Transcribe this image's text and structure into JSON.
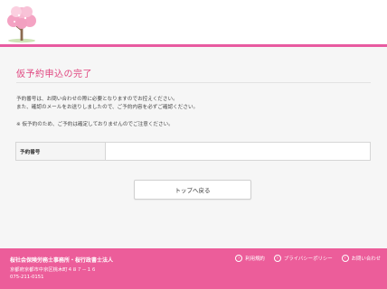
{
  "header": {
    "logo_icon": "cherry-blossom-tree-icon"
  },
  "main": {
    "title": "仮予約申込の完了",
    "messages": [
      "予約番号は、お問い合わせの際に必要となりますのでお控えください。",
      "また、確認のメールをお送りしましたので、ご予約内容を必ずご確認ください。",
      "※ 仮予約のため、ご予約は確定しておりませんのでご注意ください。"
    ],
    "reservation": {
      "label": "予約番号",
      "value": ""
    },
    "top_button_label": "トップへ戻る"
  },
  "footer": {
    "office_name": "桜社会保険労務士事務所・桜行政書士法人",
    "address": "京都府京都市中京区桃木町４８７－１６",
    "phone": "075-211-0151",
    "links": [
      {
        "label": "利用規約",
        "icon": "chevron-right-icon"
      },
      {
        "label": "プライバシーポリシー",
        "icon": "chevron-right-icon"
      },
      {
        "label": "お問い合わせ",
        "icon": "chevron-right-icon"
      }
    ]
  },
  "colors": {
    "accent": "#e85aa0",
    "title": "#e0457f",
    "footer_bg": "#ec5d9a"
  }
}
